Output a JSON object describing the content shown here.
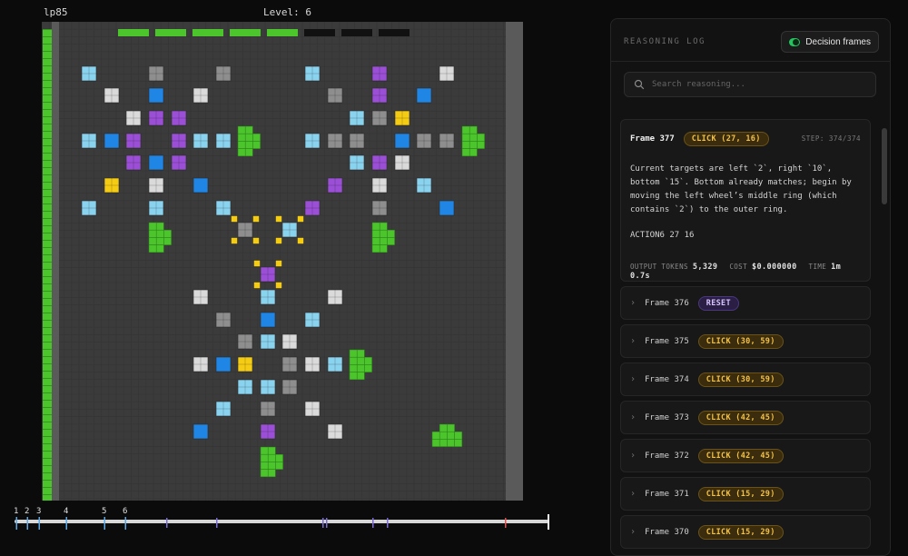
{
  "game": {
    "id": "lp85",
    "level": "Level: 6"
  },
  "timeline": {
    "markers": [
      "1",
      "2",
      "3",
      "4",
      "5",
      "6"
    ]
  },
  "panel": {
    "title": "REASONING LOG",
    "toggle_label": "Decision frames",
    "search_placeholder": "Search reasoning...",
    "expanded": {
      "frame": "Frame 377",
      "action_badge": "CLICK (27, 16)",
      "step": "STEP: 374/374",
      "text": "Current targets are left `2`, right `10`, bottom `15`. Bottom already matches; begin by moving the left wheel’s middle ring (which contains `2`) to the outer ring.",
      "action": "ACTION6 27 16",
      "output_tokens_label": "OUTPUT TOKENS",
      "output_tokens": "5,329",
      "cost_label": "COST",
      "cost": "$0.000000",
      "time_label": "TIME",
      "time": "1m 0.7s"
    },
    "rows": [
      {
        "frame": "Frame 376",
        "badge": "RESET",
        "kind": "reset"
      },
      {
        "frame": "Frame 375",
        "badge": "CLICK (30, 59)",
        "kind": "click"
      },
      {
        "frame": "Frame 374",
        "badge": "CLICK (30, 59)",
        "kind": "click"
      },
      {
        "frame": "Frame 373",
        "badge": "CLICK (42, 45)",
        "kind": "click"
      },
      {
        "frame": "Frame 372",
        "badge": "CLICK (42, 45)",
        "kind": "click"
      },
      {
        "frame": "Frame 371",
        "badge": "CLICK (15, 29)",
        "kind": "click"
      },
      {
        "frame": "Frame 370",
        "badge": "CLICK (15, 29)",
        "kind": "click"
      }
    ]
  },
  "colors": {
    "board_bg": "#3b3b3b",
    "green": "#4cc52d",
    "lightblue": "#8ad3ef",
    "gray": "#8e8e8e",
    "white": "#dadada",
    "blue": "#1f86e6",
    "purple": "#9b4fd6",
    "yellow": "#f5cc14",
    "accent_click": "#f2c14a",
    "accent_reset": "#d7c4ff"
  }
}
